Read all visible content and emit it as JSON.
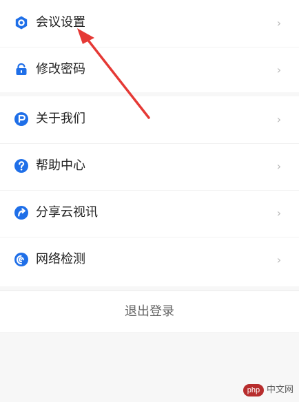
{
  "menu": {
    "group_one": [
      {
        "label": "会议设置",
        "icon": "settings-hexagon-icon"
      },
      {
        "label": "修改密码",
        "icon": "lock-icon"
      }
    ],
    "group_two": [
      {
        "label": "关于我们",
        "icon": "p-badge-icon"
      },
      {
        "label": "帮助中心",
        "icon": "question-icon"
      },
      {
        "label": "分享云视讯",
        "icon": "share-arrow-icon"
      },
      {
        "label": "网络检测",
        "icon": "network-test-icon"
      }
    ],
    "chevron": "›"
  },
  "logout": {
    "label": "退出登录"
  },
  "watermark": {
    "badge": "php",
    "text": "中文网"
  },
  "colors": {
    "accent": "#1f6fe8",
    "annotation_arrow": "#e53935"
  }
}
